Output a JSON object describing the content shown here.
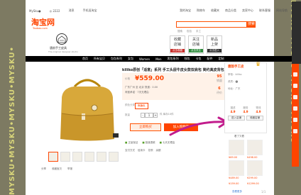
{
  "watermark": {
    "text": "MYSKU•MYSKU•MYSKU•MYSKU•"
  },
  "topbar": {
    "left": [
      "MySku●",
      "◎ 2222",
      "消息",
      "手机逛淘宝"
    ],
    "right": [
      "我的淘宝",
      "购物车",
      "收藏夹",
      "商品分类",
      "卖家中心",
      "联系客服",
      "网站导航"
    ]
  },
  "header": {
    "logo": "淘宝网",
    "logo_sub": "Taobao.com",
    "search_button": "搜索",
    "search_tags": [
      "搜索",
      "包包",
      "手工"
    ]
  },
  "shop": {
    "name": "唐韵手工皮具",
    "subtitle": "The original designer studio"
  },
  "promos": [
    {
      "title": "收藏\n店铺",
      "badge": "点击收藏"
    },
    {
      "title": "关注\n店铺",
      "badge": "点击关注"
    },
    {
      "title": "新品\n上架",
      "badge": "点击进入"
    }
  ],
  "nav": {
    "items": [
      "首页",
      "所有宝贝",
      "包包系列",
      "女包",
      "Women",
      "Men",
      "男包系列",
      "钱包",
      "卡包",
      "配件",
      "定制"
    ]
  },
  "product": {
    "title": "kiliko原创「适意」系列 手工头层牛皮女款双肩包 简约真皮背包",
    "price_label": "价格",
    "price": "¥559.00",
    "stats": [
      {
        "label": "销量",
        "value": "95"
      },
      {
        "label": "评价",
        "value": "6"
      }
    ],
    "ship": "广东广州 至 北京 快递：0.00",
    "ship2": "淘宝承诺 · 7天无理由",
    "color_label": "颜色分类",
    "sku": "焦糖色",
    "qty_label": "数量",
    "qty": "1",
    "stock": "件 库存10件",
    "buy_label": "立即购买",
    "cart_label": "加入购物车",
    "promises": [
      "正品保证",
      "极速退款",
      "七天无理由"
    ],
    "payments": [
      "支付方式",
      "信用卡",
      "花呗",
      "余额"
    ]
  },
  "gallery": {
    "thumb_count": 6,
    "share": [
      "分享",
      "收藏宝贝",
      "举报"
    ]
  },
  "right_shop": {
    "title": "唐韵手工皮",
    "badge": "♛",
    "rows": [
      "掌柜：kiliko",
      "资质：⬤",
      "地址：广东"
    ],
    "scores": [
      {
        "label": "描述",
        "value": "4.9"
      },
      {
        "label": "服务",
        "value": "4.9"
      },
      {
        "label": "物流",
        "value": "4.9"
      }
    ],
    "buttons": [
      "进入店铺",
      "收藏店铺"
    ],
    "rec_title": "看了又看",
    "rec_prices": [
      "¥69.00",
      "¥498.00",
      "¥489.00",
      "¥299.00",
      "¥159.00",
      "¥1299.00"
    ],
    "more": "查看更多"
  },
  "colors": {
    "accent": "#ff4400",
    "arrow": "#c21c8c"
  },
  "pagenum": "1/1"
}
